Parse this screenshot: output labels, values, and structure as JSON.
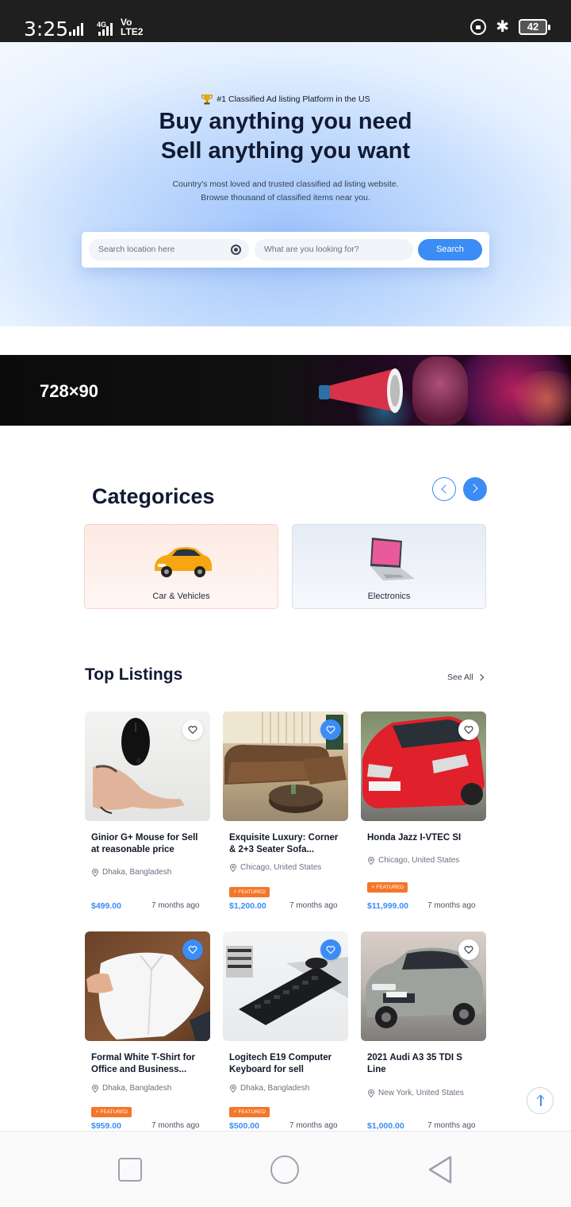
{
  "status_bar": {
    "time": "3:25",
    "net1": "4G",
    "volte": "Vo",
    "volte2": "LTE2",
    "battery": "42"
  },
  "hero": {
    "badge": "#1 Classified Ad listing Platform in the US",
    "title_line1": "Buy anything you need",
    "title_line2": "Sell anything you want",
    "subtitle_line1": "Country's most loved and trusted classified ad listing website.",
    "subtitle_line2": "Browse thousand of classified items near you.",
    "location_placeholder": "Search location here",
    "query_placeholder": "What are you looking for?",
    "search_label": "Search"
  },
  "ad": {
    "size_text": "728×90"
  },
  "categories": {
    "title": "Categorices",
    "items": [
      {
        "label": "Car & Vehicles",
        "icon": "car-icon"
      },
      {
        "label": "Electronics",
        "icon": "laptop-icon"
      }
    ]
  },
  "listings": {
    "title": "Top Listings",
    "see_all": "See All",
    "featured_label": "FEATURED",
    "items": [
      {
        "title": "Ginior G+ Mouse for Sell at reasonable price",
        "location": "Dhaka, Bangladesh",
        "price": "$499.00",
        "time": "7 months ago",
        "featured": false,
        "favorited": false
      },
      {
        "title": "Exquisite Luxury: Corner & 2+3 Seater Sofa...",
        "location": "Chicago, United States",
        "price": "$1,200.00",
        "time": "7 months ago",
        "featured": true,
        "favorited": true
      },
      {
        "title": "Honda Jazz I-VTEC SI",
        "location": "Chicago, United States",
        "price": "$11,999.00",
        "time": "7 months ago",
        "featured": true,
        "favorited": false
      },
      {
        "title": "Formal White T-Shirt for Office and Business...",
        "location": "Dhaka, Bangladesh",
        "price": "$959.00",
        "time": "7 months ago",
        "featured": true,
        "favorited": true
      },
      {
        "title": "Logitech E19 Computer Keyboard for sell",
        "location": "Dhaka, Bangladesh",
        "price": "$500.00",
        "time": "7 months ago",
        "featured": true,
        "favorited": true
      },
      {
        "title": "2021 Audi A3 35 TDI S Line",
        "location": "New York, United States",
        "price": "$1,000.00",
        "time": "7 months ago",
        "featured": false,
        "favorited": false
      }
    ]
  },
  "colors": {
    "accent": "#3b8cf5",
    "featured": "#f4762a",
    "heading": "#111a33"
  }
}
